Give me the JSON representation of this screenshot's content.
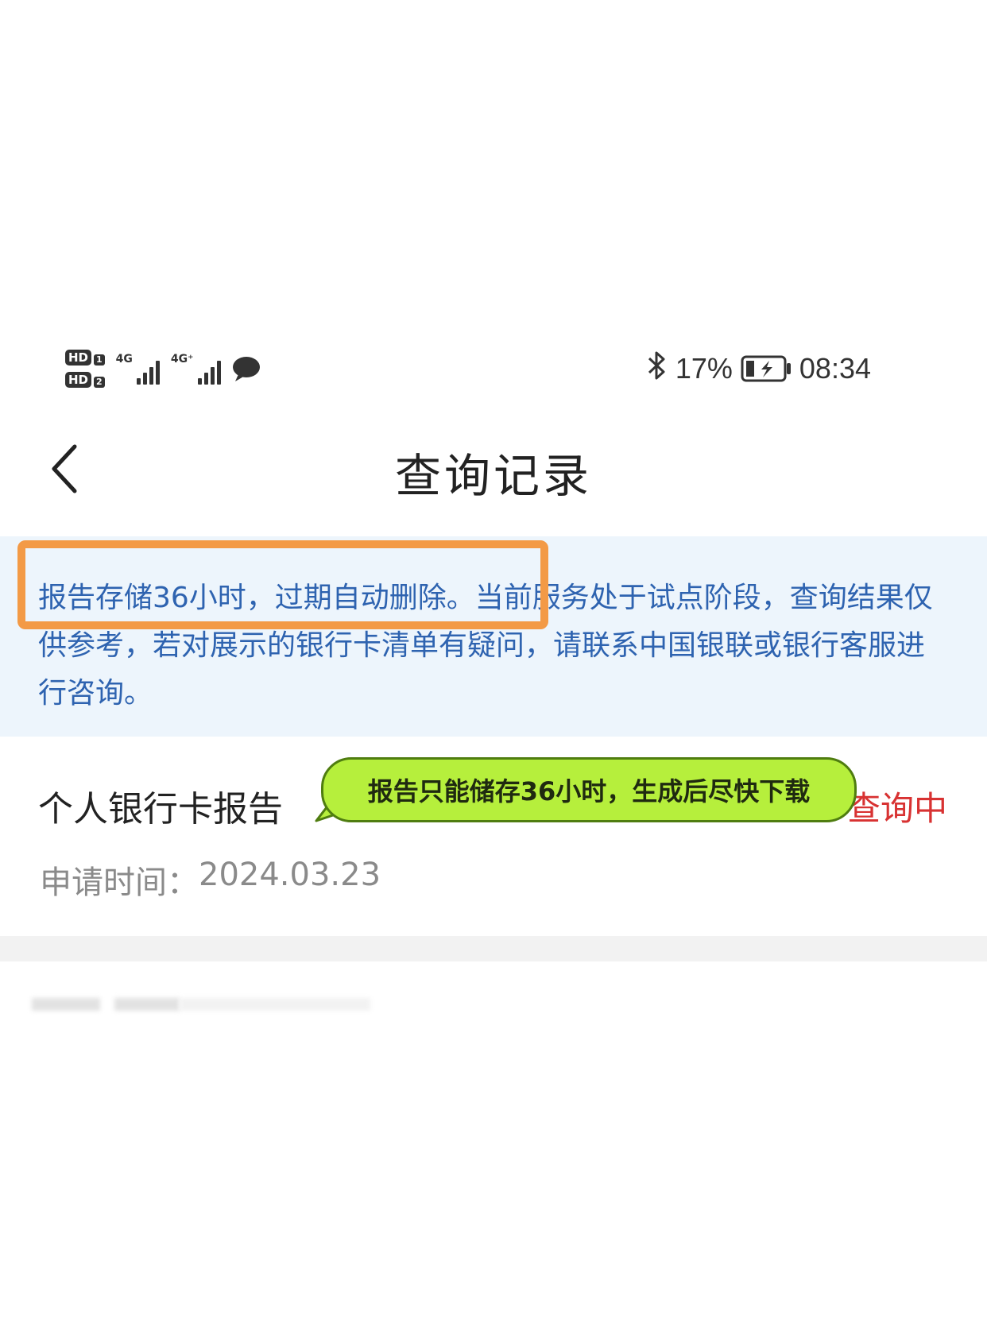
{
  "status_bar": {
    "sim1_label": "HD",
    "sim1_index": "1",
    "sim2_label": "HD",
    "sim2_index": "2",
    "network1": "4G",
    "network2": "4G⁺",
    "battery_percent": "17%",
    "time": "08:34",
    "icons": [
      "hd-sim-icon",
      "signal-icon",
      "chat-bubble-icon",
      "bluetooth-icon",
      "battery-charging-icon"
    ]
  },
  "nav": {
    "back_icon": "chevron-left-icon",
    "title": "查询记录"
  },
  "notice": {
    "text": "报告存储36小时，过期自动删除。当前服务处于试点阶段，查询结果仅供参考，若对展示的银行卡清单有疑问，请联系中国银联或银行客服进行咨询。"
  },
  "record": {
    "title": "个人银行卡报告",
    "status": "查询中",
    "date_label": "申请时间：",
    "date_value": "2024.03.23"
  },
  "annotation": {
    "callout_text": "报告只能储存36小时，生成后尽快下载"
  },
  "colors": {
    "notice_bg": "#edf5fc",
    "notice_text": "#2e63b0",
    "status_red": "#d83232",
    "highlight_orange": "#f39a46",
    "callout_green": "#b6ef3c"
  }
}
